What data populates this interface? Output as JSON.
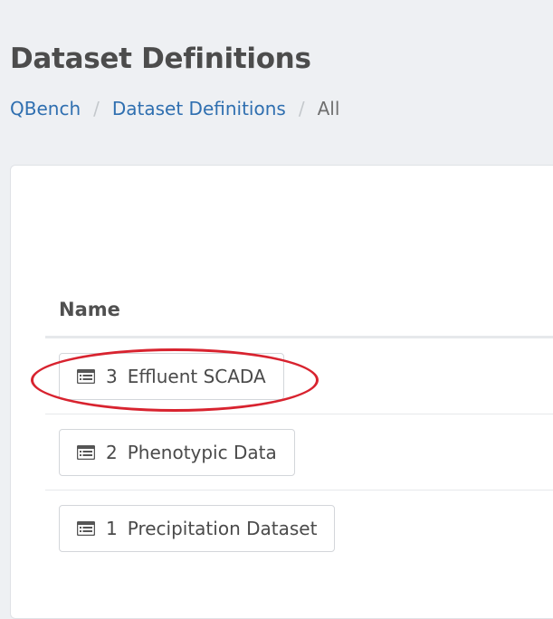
{
  "header": {
    "title": "Dataset Definitions"
  },
  "breadcrumb": {
    "items": [
      "QBench",
      "Dataset Definitions",
      "All"
    ],
    "separator": "/"
  },
  "table": {
    "column_header": "Name",
    "rows": [
      {
        "number": "3",
        "name": "Effluent SCADA",
        "icon": "list-icon"
      },
      {
        "number": "2",
        "name": "Phenotypic Data",
        "icon": "list-icon"
      },
      {
        "number": "1",
        "name": "Precipitation Dataset",
        "icon": "list-icon"
      }
    ]
  },
  "annotation": {
    "color": "#d8232f"
  },
  "colors": {
    "link": "#2f6fb0",
    "background": "#eef0f3",
    "panel": "#ffffff"
  }
}
